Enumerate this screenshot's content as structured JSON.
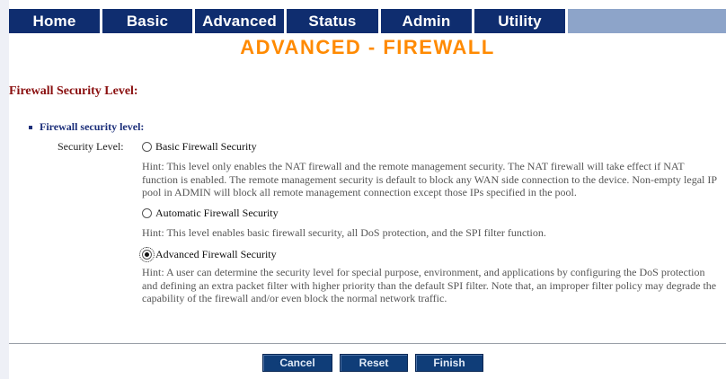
{
  "nav": {
    "tabs": [
      {
        "label": "Home"
      },
      {
        "label": "Basic"
      },
      {
        "label": "Advanced"
      },
      {
        "label": "Status"
      },
      {
        "label": "Admin"
      },
      {
        "label": "Utility"
      }
    ]
  },
  "page": {
    "title": "ADVANCED - FIREWALL",
    "section_heading": "Firewall Security Level:",
    "bullet_label": "Firewall security level:",
    "security_level_label": "Security Level:"
  },
  "options": [
    {
      "label": "Basic Firewall Security",
      "selected": false,
      "hint": "Hint: This level only enables the NAT firewall and the remote management security. The NAT firewall will take effect if NAT function is enabled. The remote management security is default to block any WAN side connection to the device. Non-empty legal IP pool in ADMIN will block all remote management connection except those IPs specified in the pool."
    },
    {
      "label": "Automatic Firewall Security",
      "selected": false,
      "hint": "Hint: This level enables basic firewall security, all DoS protection, and the SPI filter function."
    },
    {
      "label": "Advanced Firewall Security",
      "selected": true,
      "hint": "Hint: A user can determine the security level for special purpose, environment, and applications by configuring the DoS protection and defining an extra packet filter with higher priority than the default SPI filter. Note that, an improper filter policy may degrade the capability of the firewall and/or even block the normal network traffic."
    }
  ],
  "buttons": {
    "cancel": "Cancel",
    "reset": "Reset",
    "finish": "Finish"
  },
  "colors": {
    "nav_tab_bg": "#0f2d6f",
    "nav_bar_bg": "#8da4c9",
    "title": "#ff8a00",
    "section_heading": "#8a1010",
    "button_bg": "#0f3d78"
  }
}
